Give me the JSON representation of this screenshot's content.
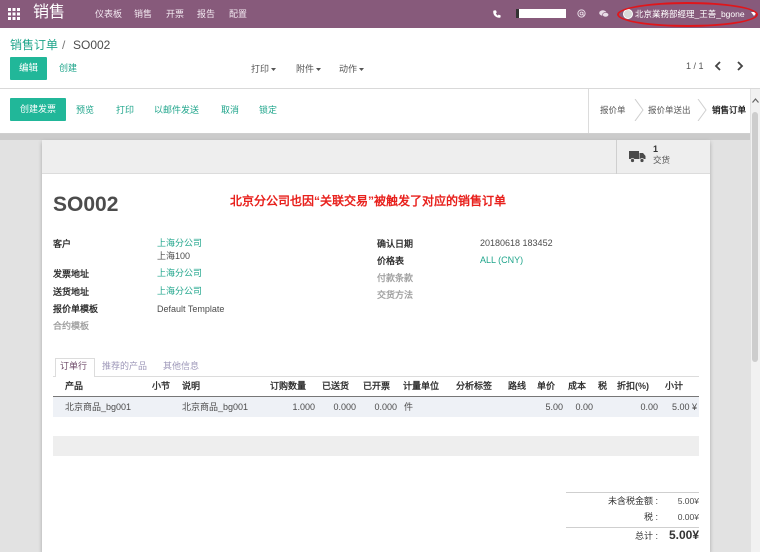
{
  "colors": {
    "navbar": "#875A7B",
    "primary_button": "#21B799",
    "link": "#1FA58B",
    "annotation": "#E8211D",
    "highlight_ring": "#E0161B"
  },
  "navbar": {
    "app_title": "销售",
    "menu": [
      "仪表板",
      "销售",
      "开票",
      "报告",
      "配置"
    ],
    "user_name": "北京業務部經理_王善_bgone",
    "icons": [
      "apps-grid-icon",
      "phone-icon",
      "mention-at-icon",
      "chat-icon",
      "avatar",
      "caret-down-icon"
    ]
  },
  "breadcrumb": {
    "parent": "销售订单",
    "separator": "/",
    "current": "SO002"
  },
  "control_panel": {
    "edit_label": "编辑",
    "create_label": "创建",
    "dropdowns": [
      "打印",
      "附件",
      "动作"
    ],
    "pager": "1 / 1",
    "icons": [
      "caret-down-icon",
      "chevron-left-icon",
      "chevron-right-icon"
    ]
  },
  "statusbar": {
    "primary_button": "创建发票",
    "links": [
      "预览",
      "打印",
      "以邮件发送",
      "取消",
      "锁定"
    ],
    "states": [
      {
        "label": "报价单",
        "active": false
      },
      {
        "label": "报价单送出",
        "active": false
      },
      {
        "label": "销售订单",
        "active": true
      }
    ]
  },
  "button_box": {
    "delivery_count": "1",
    "delivery_label": "交货",
    "icon": "truck-icon"
  },
  "sheet": {
    "title": "SO002",
    "annotation": "北京分公司也因“关联交易”被触发了对应的销售订单",
    "left": {
      "customer_label": "客户",
      "customer_name": "上海分公司",
      "customer_address": "上海100",
      "invoice_address_label": "发票地址",
      "invoice_address": "上海分公司",
      "delivery_address_label": "送货地址",
      "delivery_address": "上海分公司",
      "quote_template_label": "报价单模板",
      "quote_template": "Default Template",
      "contract_template_label": "合约模板"
    },
    "right": {
      "confirmation_date_label": "确认日期",
      "confirmation_date": "20180618 183452",
      "pricelist_label": "价格表",
      "pricelist": "ALL (CNY)",
      "payment_terms_label": "付款条款",
      "delivery_method_label": "交货方法"
    }
  },
  "tabs": [
    {
      "label": "订单行",
      "active": true
    },
    {
      "label": "推荐的产品",
      "active": false
    },
    {
      "label": "其他信息",
      "active": false
    }
  ],
  "order_lines": {
    "columns": [
      "产品",
      "小节",
      "说明",
      "订购数量",
      "已送货",
      "已开票",
      "计量单位",
      "分析标签",
      "路线",
      "单价",
      "成本",
      "税",
      "折扣(%)",
      "小计"
    ],
    "rows": [
      {
        "product": "北京商品_bg001",
        "description": "北京商品_bg001",
        "qty": "1.000",
        "delivered": "0.000",
        "invoiced": "0.000",
        "uom": "件",
        "price_unit": "5.00",
        "cost": "0.00",
        "discount": "0.00",
        "subtotal": "5.00 ¥"
      }
    ]
  },
  "totals": {
    "untaxed_label": "未含税金额 :",
    "untaxed": "5.00¥",
    "tax_label": "税 :",
    "tax": "0.00¥",
    "total_label": "总计 :",
    "total": "5.00¥"
  }
}
